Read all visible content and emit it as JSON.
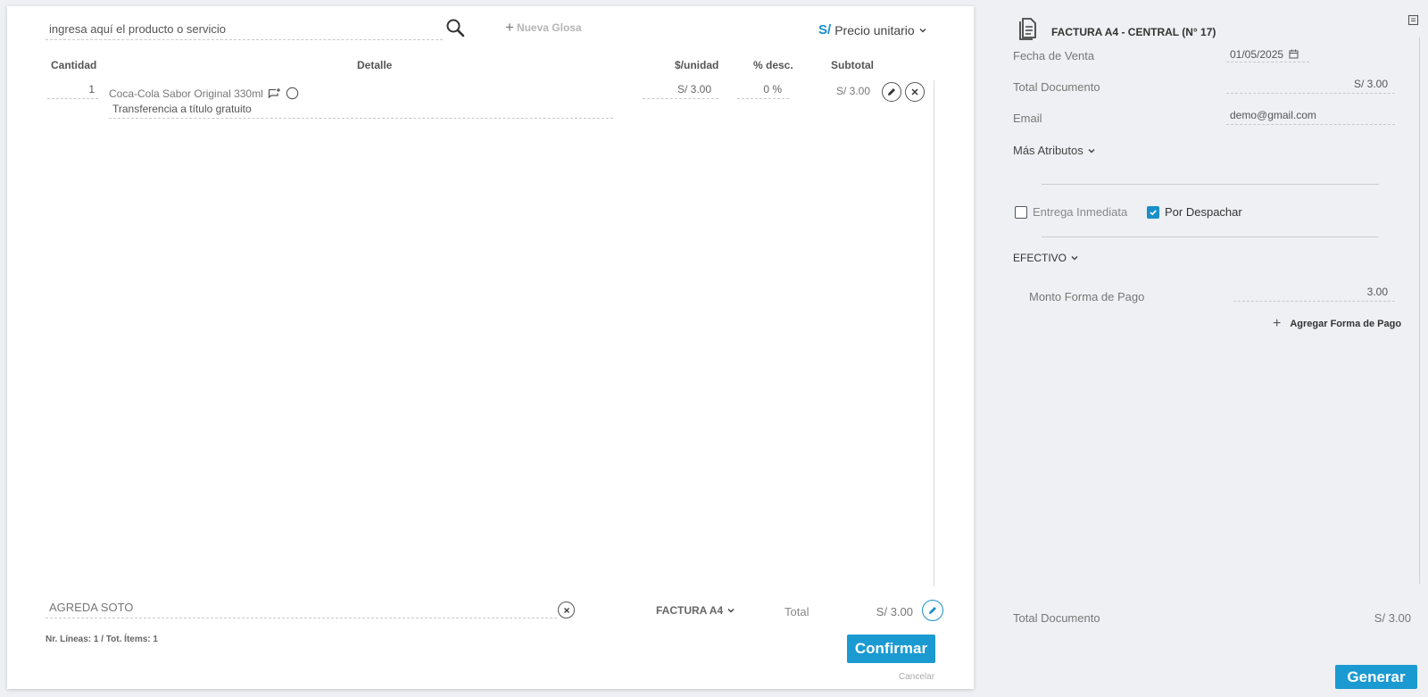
{
  "search": {
    "placeholder": "ingresa aquí el producto o servicio"
  },
  "toolbar": {
    "new_glosa": "Nueva Glosa",
    "currency_symbol": "S/",
    "price_mode": "Precio unitario"
  },
  "columns": {
    "qty": "Cantidad",
    "detail": "Detalle",
    "unit_price": "$/unidad",
    "discount": "% desc.",
    "subtotal": "Subtotal"
  },
  "line": {
    "qty": "1",
    "product": "Coca-Cola Sabor Original 330ml",
    "detail": "Transferencia a título gratuito",
    "unit_price": "S/ 3.00",
    "discount": "0 %",
    "subtotal": "S/ 3.00"
  },
  "footer": {
    "client": "AGREDA SOTO",
    "doc_type": "FACTURA A4",
    "total_label": "Total",
    "total_value": "S/ 3.00",
    "counts": "Nr. Líneas: 1 / Tot. Ítems: 1",
    "confirm": "Confirmar",
    "cancel": "Cancelar"
  },
  "side": {
    "doc_title": "FACTURA A4 - CENTRAL (N° 17)",
    "fecha_label": "Fecha de Venta",
    "fecha_value": "01/05/2025",
    "total_doc_label": "Total Documento",
    "total_doc_value": "S/ 3.00",
    "email_label": "Email",
    "email_value": "demo@gmail.com",
    "mas_atributos": "Más Atributos",
    "entrega": "Entrega Inmediata",
    "despachar": "Por Despachar",
    "efectivo": "EFECTIVO",
    "monto_label": "Monto Forma de Pago",
    "monto_value": "3.00",
    "add_pago": "Agregar Forma de Pago",
    "bottom_total_label": "Total Documento",
    "bottom_total_value": "S/ 3.00",
    "generar": "Generar"
  },
  "colors": {
    "accent": "#1a9ad1",
    "check": "#1a8fc9"
  }
}
